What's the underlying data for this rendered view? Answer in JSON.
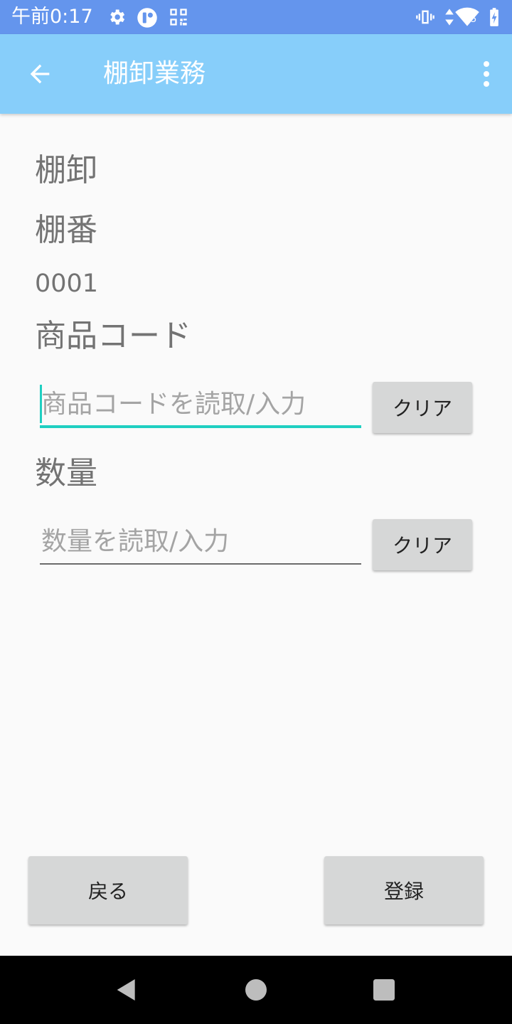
{
  "status_bar": {
    "time": "午前0:17",
    "left_icons": [
      "gear-icon",
      "app-badge-icon",
      "qr-code-icon"
    ],
    "right_icons": [
      "vibrate-icon",
      "data-arrows-icon",
      "wifi-icon",
      "battery-charging-icon"
    ],
    "wifi_badge": "5"
  },
  "app_bar": {
    "title": "棚卸業務",
    "background": "#87cefa"
  },
  "form": {
    "section_title": "棚卸",
    "shelf_label": "棚番",
    "shelf_value": "0001",
    "product_code": {
      "label": "商品コード",
      "placeholder": "商品コードを読取/入力",
      "value": "",
      "clear_label": "クリア"
    },
    "quantity": {
      "label": "数量",
      "placeholder": "数量を読取/入力",
      "value": "",
      "clear_label": "クリア"
    }
  },
  "actions": {
    "back_label": "戻る",
    "register_label": "登録"
  },
  "colors": {
    "status_bar": "#6495ed",
    "accent": "#1fcfc1",
    "button": "#d6d7d7"
  }
}
